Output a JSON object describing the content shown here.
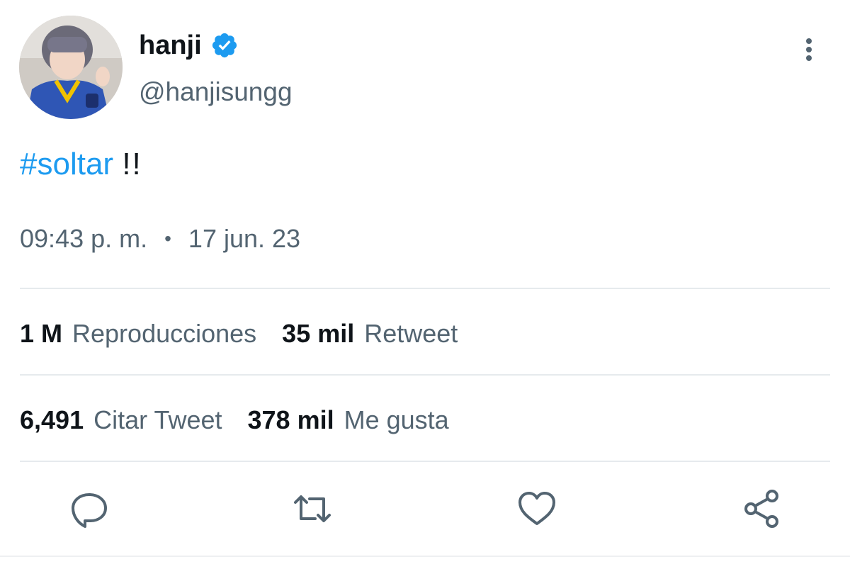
{
  "author": {
    "display_name": "hanji",
    "handle": "@hanjisungg",
    "verified": true,
    "verified_color": "#1d9bf0"
  },
  "tweet": {
    "hashtag": "#soltar",
    "text_rest": "!!",
    "time": "09:43 p. m.",
    "separator": "•",
    "date": "17 jun. 23"
  },
  "stats": {
    "views_count": "1 M",
    "views_label": "Reproducciones",
    "retweets_count": "35 mil",
    "retweets_label": "Retweet",
    "quotes_count": "6,491",
    "quotes_label": "Citar Tweet",
    "likes_count": "378 mil",
    "likes_label": "Me gusta"
  },
  "actions": {
    "icons": [
      "reply-icon",
      "retweet-icon",
      "like-icon",
      "share-icon"
    ]
  },
  "colors": {
    "accent": "#1d9bf0",
    "secondary_text": "#536471",
    "primary_text": "#0f1419",
    "divider": "#e6eaed"
  }
}
